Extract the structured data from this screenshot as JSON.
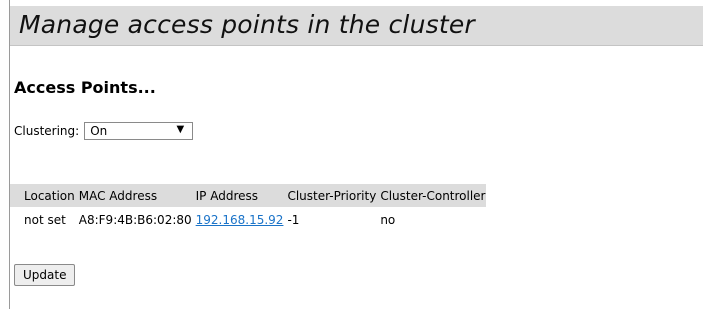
{
  "header": {
    "title": "Manage access points in the cluster"
  },
  "section": {
    "heading": "Access Points..."
  },
  "clustering": {
    "label": "Clustering:",
    "selected": "On",
    "arrow_icon": "triangle-down-icon"
  },
  "table": {
    "columns": [
      "Location",
      "MAC Address",
      "IP Address",
      "Cluster-Priority",
      "Cluster-Controller"
    ],
    "rows": [
      {
        "location": "not set",
        "mac": "A8:F9:4B:B6:02:80",
        "ip": "192.168.15.92",
        "priority": "-1",
        "controller": "no"
      }
    ]
  },
  "actions": {
    "update_label": "Update"
  },
  "colors": {
    "header_bg": "#dcdcdc",
    "link": "#1a73c8"
  }
}
